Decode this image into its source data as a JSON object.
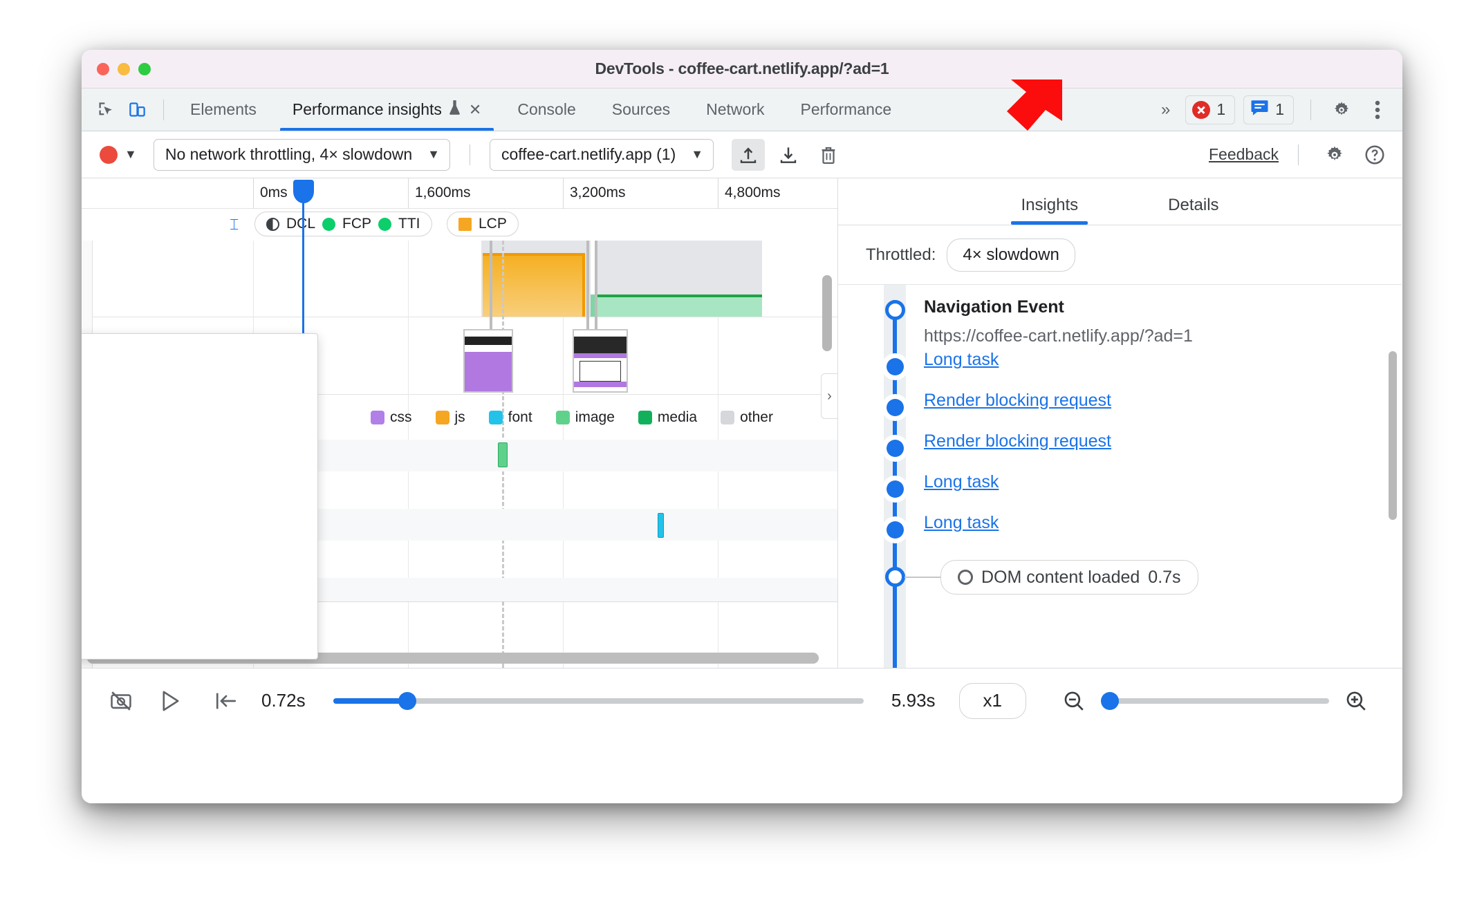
{
  "window": {
    "title": "DevTools - coffee-cart.netlify.app/?ad=1",
    "traffic_lights": [
      "close-red",
      "minimize-yellow",
      "maximize-green"
    ]
  },
  "tabstrip": {
    "left_icons": [
      {
        "name": "inspect-element-icon"
      },
      {
        "name": "device-toolbar-icon"
      }
    ],
    "tabs": [
      {
        "label": "Elements",
        "active": false,
        "flask": false,
        "closable": false
      },
      {
        "label": "Performance insights",
        "active": true,
        "flask": true,
        "flask_glyph": "⚗",
        "close_glyph": "✕",
        "closable": true
      },
      {
        "label": "Console",
        "active": false,
        "flask": false,
        "closable": false
      },
      {
        "label": "Sources",
        "active": false,
        "flask": false,
        "closable": false
      },
      {
        "label": "Network",
        "active": false,
        "flask": false,
        "closable": false
      },
      {
        "label": "Performance",
        "active": false,
        "flask": false,
        "closable": false
      }
    ],
    "overflow_glyph": "»",
    "error_badge": {
      "icon": "error-circle-icon",
      "count": "1"
    },
    "message_badge": {
      "icon": "message-bubble-icon",
      "count": "1"
    },
    "settings_icon": "gear-icon",
    "more_icon": "kebab-menu-icon"
  },
  "perf_toolbar": {
    "record_button": "record-circle-icon",
    "record_dropdown_glyph": "▼",
    "throttling_select": {
      "value": "No network throttling, 4× slowdown",
      "caret": "▼"
    },
    "origin_select": {
      "value": "coffee-cart.netlify.app (1)",
      "caret": "▼"
    },
    "upload_button": "upload-import-icon",
    "download_button": "download-export-icon",
    "delete_button": "trash-icon",
    "feedback_label": "Feedback",
    "settings_icon": "gear-icon",
    "help_icon": "help-circle-icon"
  },
  "timeline": {
    "ruler_ticks": [
      "0ms",
      "1,600ms",
      "3,200ms",
      "4,800ms"
    ],
    "markers": [
      {
        "label": "DCL",
        "swatch": "half-circle",
        "color": "#3c4043"
      },
      {
        "label": "FCP",
        "swatch": "circle",
        "color": "#0cce6b"
      },
      {
        "label": "TTI",
        "swatch": "circle",
        "color": "#0cce6b"
      },
      {
        "label": "LCP",
        "swatch": "square",
        "color": "#f5a623"
      }
    ],
    "network_legend": [
      {
        "label": "css",
        "color": "#b07fe8"
      },
      {
        "label": "js",
        "color": "#f5a623"
      },
      {
        "label": "font",
        "color": "#23c2e8"
      },
      {
        "label": "image",
        "color": "#5fd18b"
      },
      {
        "label": "media",
        "color": "#11b15c"
      },
      {
        "label": "other",
        "color": "#d5d7da"
      }
    ],
    "pane_handle_glyph": "›",
    "expander_glyph": "▶"
  },
  "sidebar": {
    "tabs": [
      {
        "label": "Insights",
        "active": true
      },
      {
        "label": "Details",
        "active": false
      }
    ],
    "throttled_label": "Throttled:",
    "throttled_value": "4× slowdown",
    "navigation": {
      "title": "Navigation Event",
      "url": "https://coffee-cart.netlify.app/?ad=1"
    },
    "items": [
      {
        "label": "Long task",
        "type": "link"
      },
      {
        "label": "Render blocking request",
        "type": "link"
      },
      {
        "label": "Render blocking request",
        "type": "link"
      },
      {
        "label": "Long task",
        "type": "link"
      },
      {
        "label": "Long task",
        "type": "link"
      }
    ],
    "end_event": {
      "label": "DOM content loaded",
      "time": "0.7s",
      "icon": "ring-icon"
    }
  },
  "bottombar": {
    "screenshot_toggle_icon": "screenshot-off-icon",
    "play_icon": "play-triangle-icon",
    "jump_start_icon": "jump-to-start-icon",
    "start_time": "0.72s",
    "end_time": "5.93s",
    "speed_value": "x1",
    "zoom_out_icon": "zoom-out-icon",
    "zoom_in_icon": "zoom-in-icon"
  },
  "colors": {
    "accent": "#1a73e8",
    "record": "#ec4a3d",
    "error": "#e02b27",
    "lcp": "#f29900",
    "shift": "#1ea446",
    "cursor_arrow": "#fb0d0d"
  }
}
